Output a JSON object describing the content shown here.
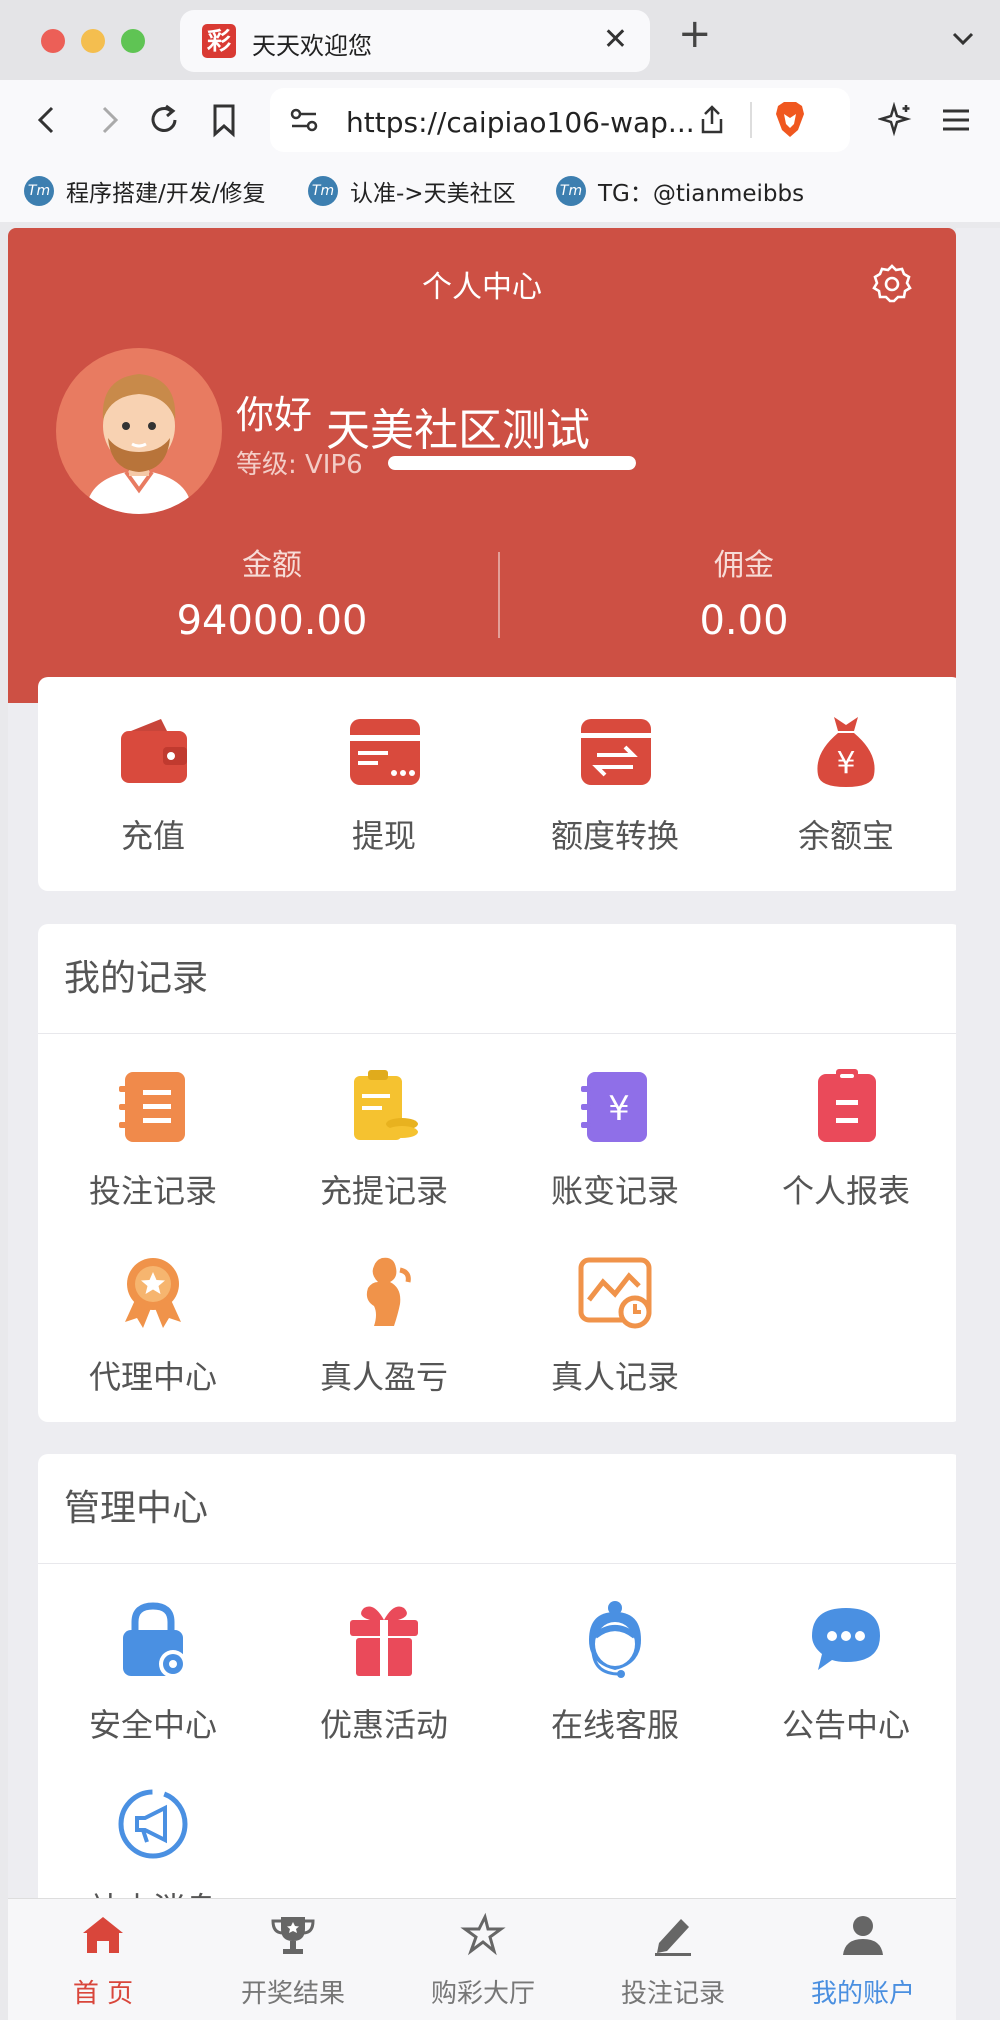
{
  "browser": {
    "tab_title": "天天欢迎您",
    "favicon_glyph": "彩",
    "tab_close": "✕",
    "new_tab": "+",
    "url": "https://caipiao106-wap...",
    "bookmarks": [
      {
        "label": "程序搭建/开发/修复",
        "icon_text": "Tm"
      },
      {
        "label": "认准->天美社区",
        "icon_text": "Tm"
      },
      {
        "label": "TG：@tianmeibbs",
        "icon_text": "Tm"
      }
    ]
  },
  "header": {
    "title": "个人中心",
    "greeting": "你好",
    "username": "天美社区测试",
    "level_label": "等级:  VIP6",
    "level_progress": 1.0,
    "balance_label": "金额",
    "balance_value": "94000.00",
    "commission_label": "佣金",
    "commission_value": "0.00",
    "accent_color": "#cd5044"
  },
  "quick_actions": [
    {
      "label": "充值",
      "icon": "wallet-icon"
    },
    {
      "label": "提现",
      "icon": "card-icon"
    },
    {
      "label": "额度转换",
      "icon": "transfer-icon"
    },
    {
      "label": "余额宝",
      "icon": "money-bag-icon"
    }
  ],
  "records": {
    "title": "我的记录",
    "items": [
      {
        "label": "投注记录",
        "icon": "bet-record-icon",
        "color": "#f08a4b"
      },
      {
        "label": "充提记录",
        "icon": "deposit-record-icon",
        "color": "#f5c230"
      },
      {
        "label": "账变记录",
        "icon": "account-change-icon",
        "color": "#8f6fe8"
      },
      {
        "label": "个人报表",
        "icon": "report-icon",
        "color": "#ea4a5a"
      },
      {
        "label": "代理中心",
        "icon": "agent-medal-icon",
        "color": "#f0934a"
      },
      {
        "label": "真人盈亏",
        "icon": "live-profit-icon",
        "color": "#f0934a"
      },
      {
        "label": "真人记录",
        "icon": "live-record-icon",
        "color": "#f0934a"
      }
    ]
  },
  "management": {
    "title": "管理中心",
    "items": [
      {
        "label": "安全中心",
        "icon": "security-lock-icon",
        "color": "#4a90e2"
      },
      {
        "label": "优惠活动",
        "icon": "gift-icon",
        "color": "#ea4a5a"
      },
      {
        "label": "在线客服",
        "icon": "customer-service-icon",
        "color": "#4a90e2"
      },
      {
        "label": "公告中心",
        "icon": "chat-bubble-icon",
        "color": "#4a90e2"
      },
      {
        "label": "站内消息",
        "icon": "megaphone-icon",
        "color": "#4a90e2"
      }
    ]
  },
  "bottom_nav": [
    {
      "label": "首 页",
      "icon": "home-icon"
    },
    {
      "label": "开奖结果",
      "icon": "trophy-icon"
    },
    {
      "label": "购彩大厅",
      "icon": "star-icon"
    },
    {
      "label": "投注记录",
      "icon": "edit-icon"
    },
    {
      "label": "我的账户",
      "icon": "user-icon"
    }
  ]
}
